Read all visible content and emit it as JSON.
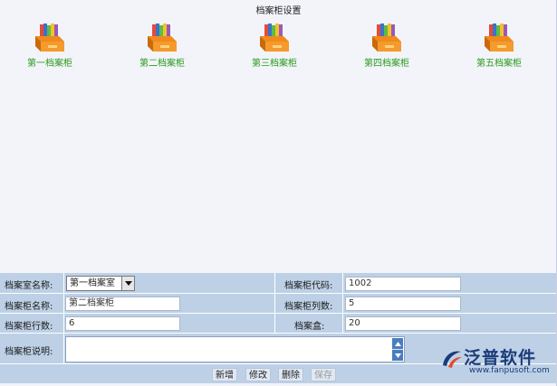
{
  "page": {
    "title": "档案柜设置"
  },
  "cabinets": [
    {
      "label": "第一档案柜"
    },
    {
      "label": "第二档案柜"
    },
    {
      "label": "第三档案柜"
    },
    {
      "label": "第四档案柜"
    },
    {
      "label": "第五档案柜"
    }
  ],
  "form": {
    "room_name_label": "档案室名称:",
    "room_name_value": "第一档案室",
    "cabinet_code_label": "档案柜代码:",
    "cabinet_code_value": "1002",
    "cabinet_name_label": "档案柜名称:",
    "cabinet_name_value": "第二档案柜",
    "column_count_label": "档案柜列数:",
    "column_count_value": "5",
    "row_count_label": "档案柜行数:",
    "row_count_value": "6",
    "box_label": "档案盒:",
    "box_value": "20",
    "description_label": "档案柜说明:",
    "description_value": ""
  },
  "buttons": {
    "add": "新增",
    "modify": "修改",
    "delete": "删除",
    "save": "保存"
  },
  "watermark": {
    "brand": "泛普软件",
    "url": "www.fanpusoft.com"
  },
  "icons": {
    "cabinet": "file-cabinet-icon",
    "dropdown": "chevron-down-icon",
    "scroll_up": "chevron-up-icon",
    "scroll_down": "chevron-down-icon",
    "logo": "fanpu-logo-icon"
  },
  "colors": {
    "panel": "#bdd0e6",
    "background": "#f2f4fa",
    "cabinet_label": "#2a9a1a",
    "brand": "#1b3c78"
  }
}
